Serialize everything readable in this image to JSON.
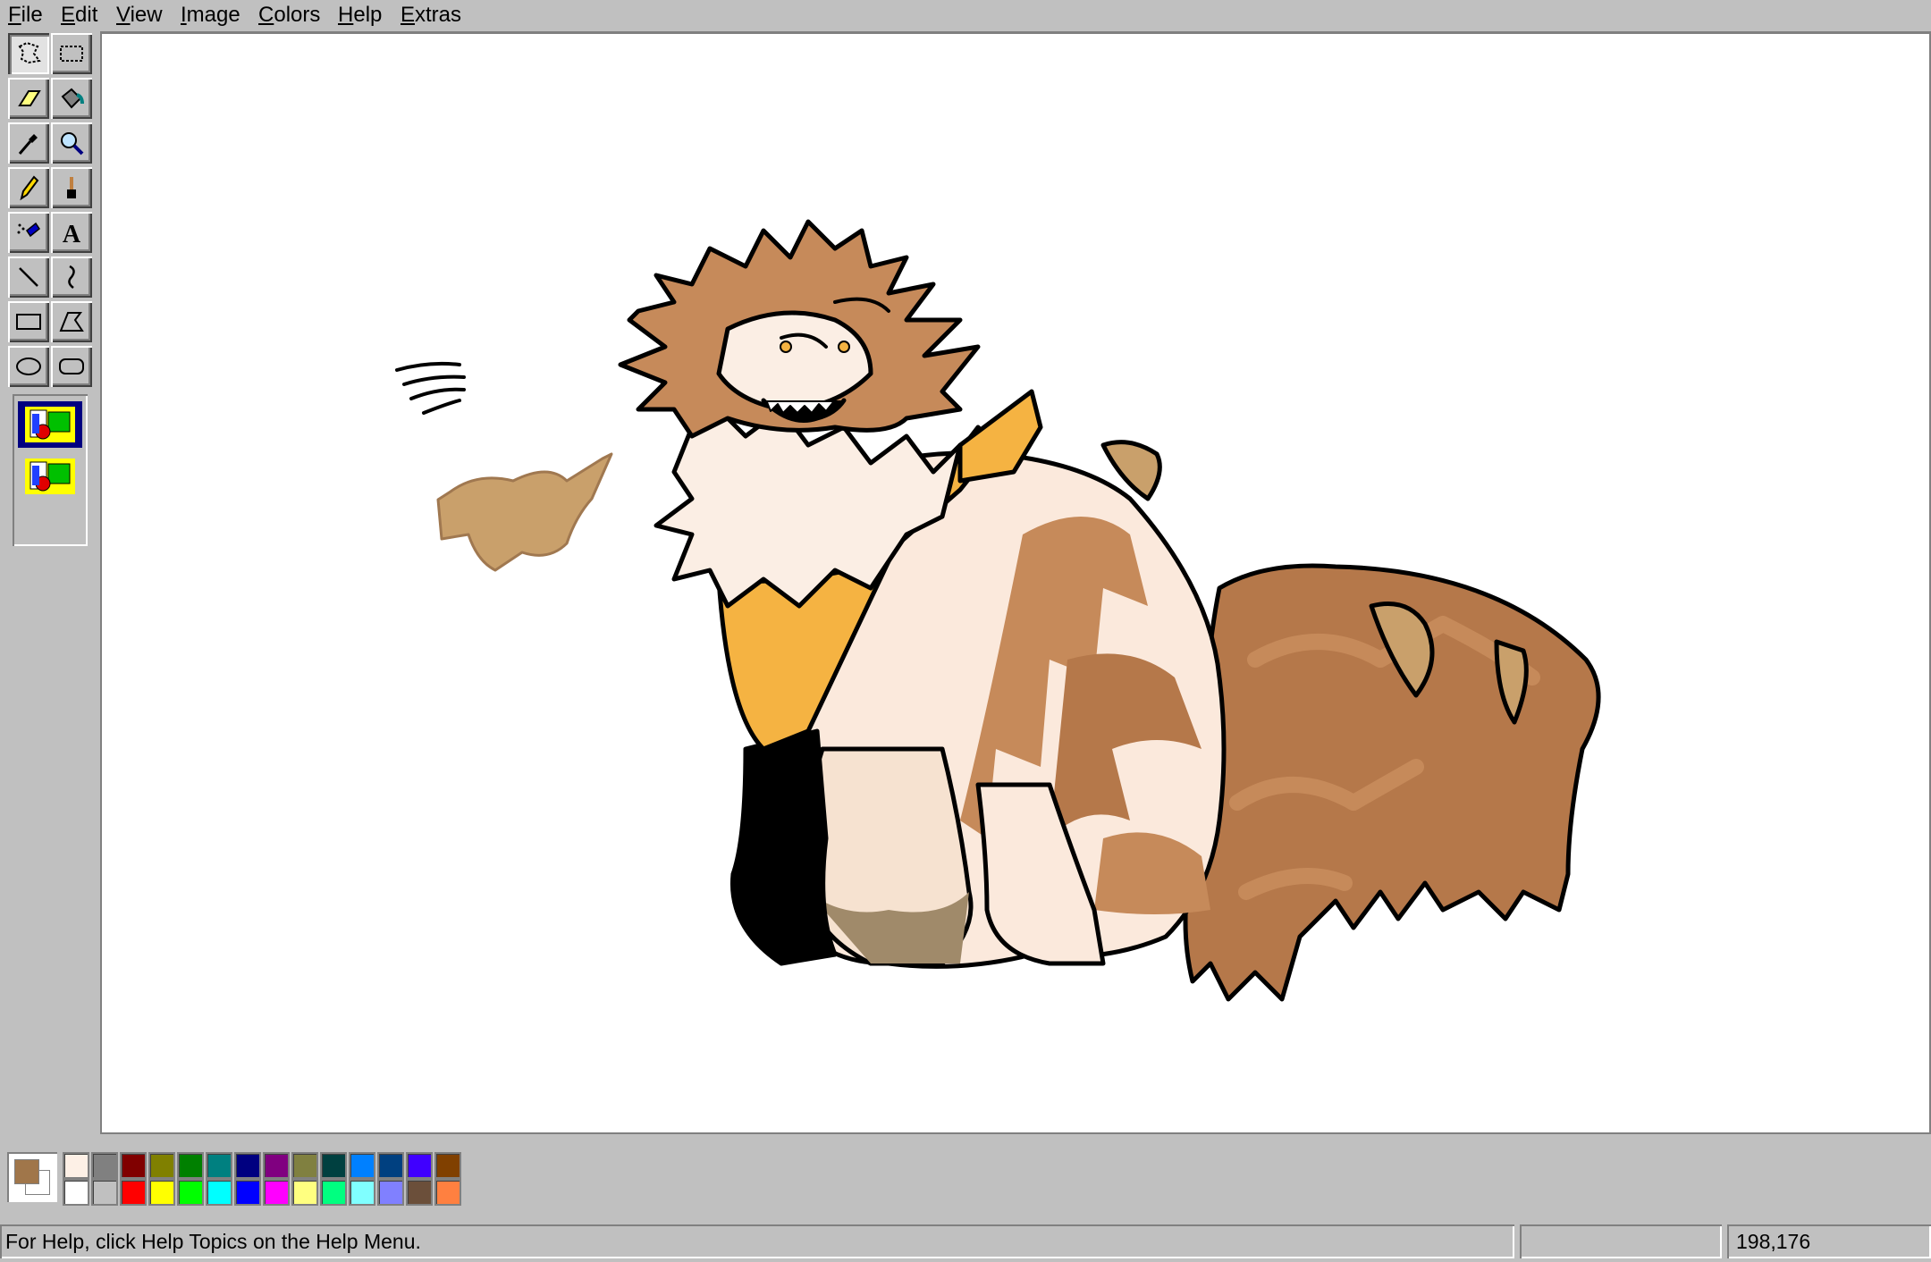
{
  "menu": [
    "File",
    "Edit",
    "View",
    "Image",
    "Colors",
    "Help",
    "Extras"
  ],
  "tools": [
    {
      "icon": "free-form-select-icon",
      "pressed": true
    },
    {
      "icon": "rectangle-select-icon"
    },
    {
      "icon": "eraser-icon"
    },
    {
      "icon": "fill-bucket-icon"
    },
    {
      "icon": "color-picker-icon"
    },
    {
      "icon": "magnifier-icon"
    },
    {
      "icon": "pencil-icon"
    },
    {
      "icon": "brush-icon"
    },
    {
      "icon": "airbrush-icon"
    },
    {
      "icon": "text-icon",
      "glyph": "A"
    },
    {
      "icon": "line-icon"
    },
    {
      "icon": "curve-icon"
    },
    {
      "icon": "rectangle-icon"
    },
    {
      "icon": "polygon-icon"
    },
    {
      "icon": "ellipse-icon"
    },
    {
      "icon": "rounded-rectangle-icon"
    }
  ],
  "tool_options": [
    "opaque-background-icon",
    "transparent-background-icon"
  ],
  "palette": {
    "foreground": "#a0764a",
    "background": "#ffffff",
    "colors_top": [
      "#fdf0e6",
      "#808080",
      "#800000",
      "#808000",
      "#008000",
      "#008080",
      "#000080",
      "#800080",
      "#808040",
      "#004040",
      "#0080ff",
      "#004080",
      "#4000ff",
      "#804000"
    ],
    "colors_bottom": [
      "#ffffff",
      "#c0c0c0",
      "#ff0000",
      "#ffff00",
      "#00ff00",
      "#00ffff",
      "#0000ff",
      "#ff00ff",
      "#ffff80",
      "#00ff80",
      "#80ffff",
      "#8080ff",
      "#6b4f3a",
      "#ff8040"
    ]
  },
  "status": {
    "help_text": "For Help, click Help Topics on the Help Menu.",
    "coordinates": "198,176"
  }
}
